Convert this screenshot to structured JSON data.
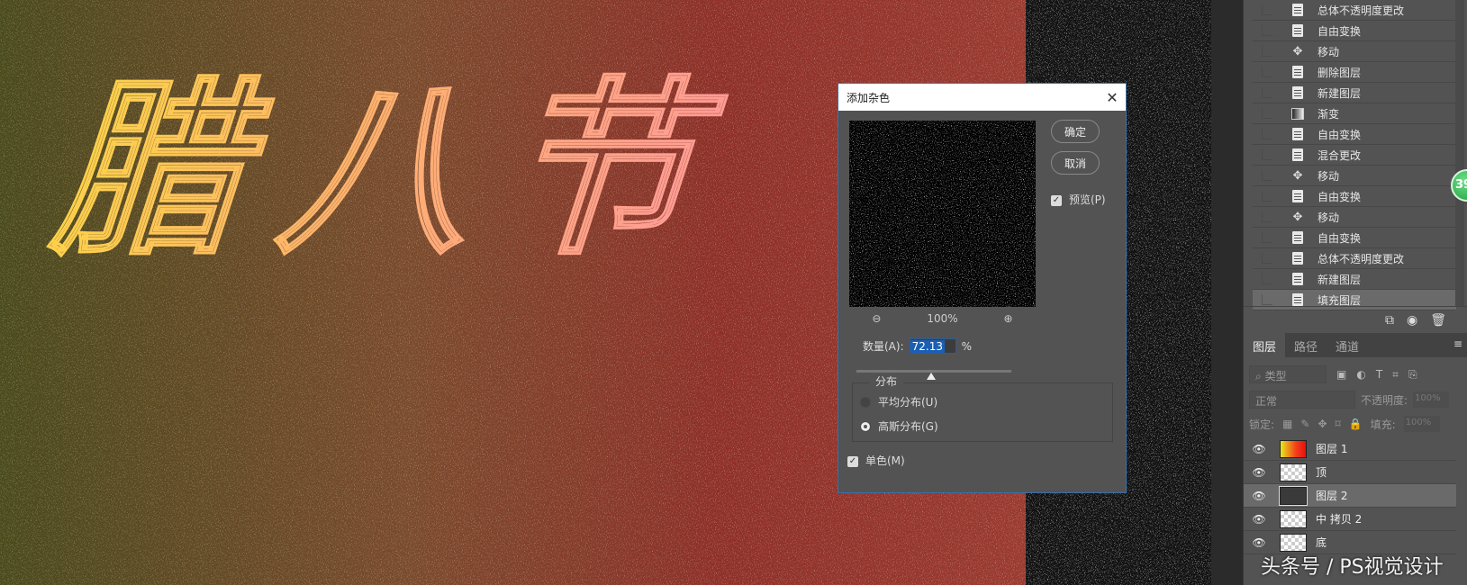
{
  "canvas": {
    "artwork_text": "腊八节"
  },
  "history": {
    "items": [
      {
        "label": "总体不透明度更改",
        "icon": "document-icon"
      },
      {
        "label": "自由变换",
        "icon": "document-icon"
      },
      {
        "label": "移动",
        "icon": "move-icon"
      },
      {
        "label": "删除图层",
        "icon": "document-icon"
      },
      {
        "label": "新建图层",
        "icon": "document-icon"
      },
      {
        "label": "渐变",
        "icon": "gradient-icon"
      },
      {
        "label": "自由变换",
        "icon": "document-icon"
      },
      {
        "label": "混合更改",
        "icon": "document-icon"
      },
      {
        "label": "移动",
        "icon": "move-icon"
      },
      {
        "label": "自由变换",
        "icon": "document-icon"
      },
      {
        "label": "移动",
        "icon": "move-icon"
      },
      {
        "label": "自由变换",
        "icon": "document-icon"
      },
      {
        "label": "总体不透明度更改",
        "icon": "document-icon"
      },
      {
        "label": "新建图层",
        "icon": "document-icon"
      },
      {
        "label": "填充图层",
        "icon": "document-icon"
      }
    ],
    "badge": "39"
  },
  "layers_panel": {
    "tabs": [
      "图层",
      "路径",
      "通道"
    ],
    "filter_placeholder": "类型",
    "blend_mode": "正常",
    "opacity_label": "不透明度:",
    "opacity_value": "100%",
    "lock_label": "锁定:",
    "fill_label": "填充:",
    "fill_value": "100%",
    "layers": [
      {
        "name": "图层 1",
        "thumb": "g"
      },
      {
        "name": "顶",
        "thumb": ""
      },
      {
        "name": "图层 2",
        "thumb": "n",
        "selected": true
      },
      {
        "name": "中 拷贝 2",
        "thumb": ""
      },
      {
        "name": "底",
        "thumb": ""
      }
    ]
  },
  "watermark": "头条号 / PS视觉设计",
  "dialog": {
    "title": "添加杂色",
    "ok": "确定",
    "cancel": "取消",
    "preview_label": "预览(P)",
    "zoom": "100%",
    "amount_label": "数量(A):",
    "amount_value": "72.13",
    "amount_unit": "%",
    "amount_fraction": 0.48,
    "distribution_label": "分布",
    "uniform_label": "平均分布(U)",
    "gaussian_label": "高斯分布(G)",
    "selected_distribution": "gaussian",
    "mono_label": "单色(M)",
    "mono_checked": true,
    "preview_checked": true
  }
}
